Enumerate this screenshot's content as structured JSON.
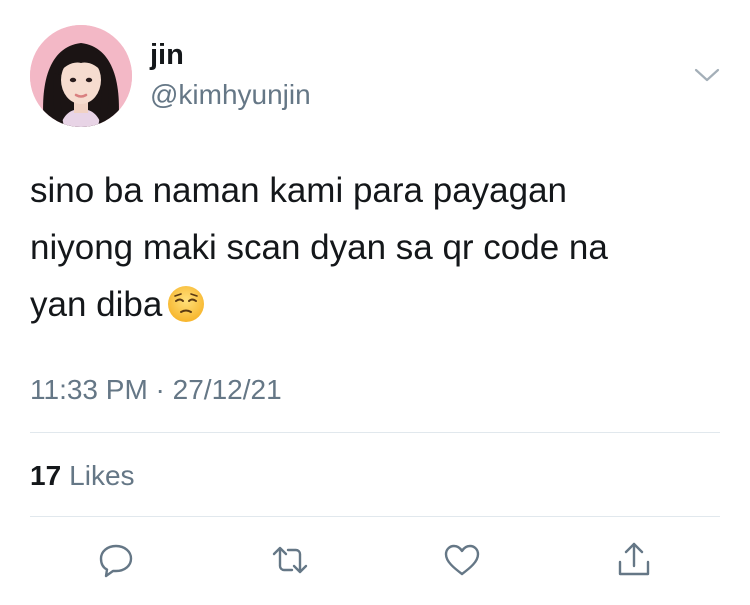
{
  "tweet": {
    "display_name": "jin",
    "handle": "@kimhyunjin",
    "text": "sino ba naman kami para payagan\nniyong maki scan dyan sa qr code na\nyan diba",
    "emoji": "pensive-face",
    "timestamp": "11:33 PM · 27/12/21",
    "likes_count": "17",
    "likes_label": "Likes"
  },
  "icons": {
    "menu": "chevron-down-icon",
    "reply": "reply-icon",
    "retweet": "retweet-icon",
    "like": "heart-icon",
    "share": "share-icon"
  },
  "colors": {
    "text": "#14171a",
    "secondary": "#657786",
    "divider": "#e1e8ed",
    "avatar_bg": "#f3b8c6"
  }
}
